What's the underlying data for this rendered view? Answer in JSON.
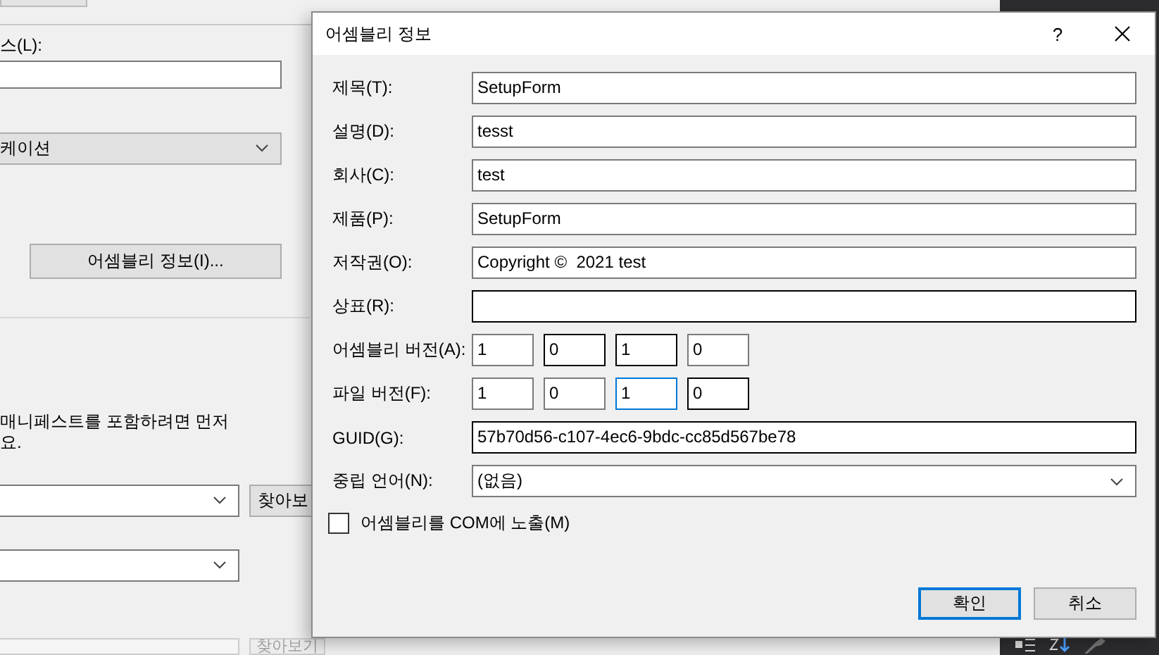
{
  "background_window": {
    "address_label": "스(L):",
    "type_select": "케이션",
    "assembly_info_button": "어셈블리 정보(I)...",
    "manifest_note": [
      "매니페스트를 포함하려면 먼저",
      "요."
    ],
    "browse_button": {
      "label": "찾아보",
      "disabled": false
    },
    "browse_button_2": {
      "label": "찾아보기",
      "disabled": true
    }
  },
  "dialog": {
    "title": "어셈블리 정보",
    "help": "?",
    "rows": [
      {
        "kind": "text",
        "label": "제목(T):",
        "value": "SetupForm",
        "hovered": false,
        "focused": false
      },
      {
        "kind": "text",
        "label": "설명(D):",
        "value": "tesst",
        "hovered": false,
        "focused": false
      },
      {
        "kind": "text",
        "label": "회사(C):",
        "value": "test",
        "hovered": false,
        "focused": false
      },
      {
        "kind": "text",
        "label": "제품(P):",
        "value": "SetupForm",
        "hovered": false,
        "focused": false
      },
      {
        "kind": "text",
        "label": "저작권(O):",
        "value": "Copyright ©  2021 test",
        "hovered": false,
        "focused": false
      },
      {
        "kind": "text",
        "label": "상표(R):",
        "hovered": true,
        "focused": false
      },
      {
        "kind": "version",
        "label": "어셈블리 버전(A):",
        "parts": [
          {
            "value": "1",
            "hovered": false,
            "focused": false
          },
          {
            "value": "0",
            "hovered": true,
            "focused": false
          },
          {
            "value": "1",
            "hovered": true,
            "focused": false
          },
          {
            "value": "0",
            "hovered": false,
            "focused": false
          }
        ]
      },
      {
        "kind": "version",
        "label": "파일 버전(F):",
        "parts": [
          {
            "value": "1",
            "hovered": false,
            "focused": false
          },
          {
            "value": "0",
            "hovered": false,
            "focused": false
          },
          {
            "value": "1",
            "hovered": false,
            "focused": true
          },
          {
            "value": "0",
            "hovered": true,
            "focused": false
          }
        ]
      },
      {
        "kind": "text",
        "label": "GUID(G):",
        "value": "57b70d56-c107-4ec6-9bdc-cc85d567be78",
        "hovered": true,
        "focused": false
      },
      {
        "kind": "dropdown",
        "label": "중립 언어(N):",
        "value": "(없음)",
        "hovered": false,
        "focused": false
      }
    ],
    "com_checkbox": {
      "label": "어셈블리를 COM에 노출(M)",
      "checked": false
    },
    "buttons": [
      {
        "label": "확인",
        "default": true
      },
      {
        "label": "취소",
        "default": false
      }
    ]
  }
}
